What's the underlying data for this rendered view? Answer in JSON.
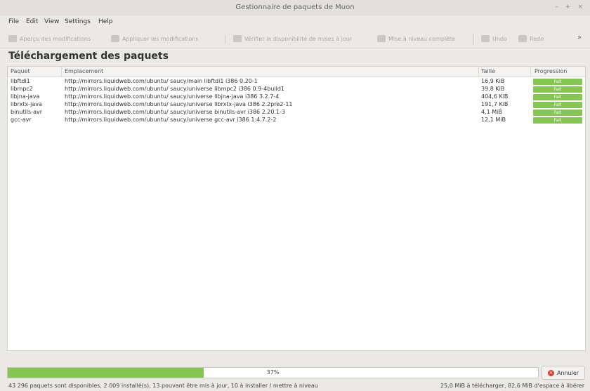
{
  "window": {
    "title": "Gestionnaire de paquets de Muon",
    "controls": [
      "–",
      "+",
      "×"
    ]
  },
  "menu": [
    {
      "label": "File"
    },
    {
      "label": "Edit"
    },
    {
      "label": "View"
    },
    {
      "label": "Settings"
    },
    {
      "label": "Help"
    }
  ],
  "toolbar": [
    {
      "label": "Aperçu des modifications",
      "icon": "preview-icon"
    },
    {
      "label": "Appliquer les modifications",
      "icon": "apply-icon"
    },
    {
      "label": "Vérifier la disponibilité de mises à jour",
      "icon": "refresh-icon"
    },
    {
      "label": "Mise à niveau complète",
      "icon": "upgrade-icon"
    },
    {
      "label": "Undo",
      "icon": "undo-icon"
    },
    {
      "label": "Redo",
      "icon": "redo-icon"
    },
    {
      "label": "»",
      "icon": "overflow-icon"
    }
  ],
  "page_title": "Téléchargement des paquets",
  "table": {
    "headers": [
      "Paquet",
      "Emplacement",
      "Taille",
      "Progression"
    ],
    "rows": [
      {
        "pkg": "libftdi1",
        "loc": "http://mirrors.liquidweb.com/ubuntu/ saucy/main libftdi1 i386 0.20-1",
        "size": "16,9 KiB",
        "progress": "Fait"
      },
      {
        "pkg": "libmpc2",
        "loc": "http://mirrors.liquidweb.com/ubuntu/ saucy/universe libmpc2 i386 0.9-4build1",
        "size": "39,8 KiB",
        "progress": "Fait"
      },
      {
        "pkg": "libjna-java",
        "loc": "http://mirrors.liquidweb.com/ubuntu/ saucy/universe libjna-java i386 3.2.7-4",
        "size": "404,6 KiB",
        "progress": "Fait"
      },
      {
        "pkg": "librxtx-java",
        "loc": "http://mirrors.liquidweb.com/ubuntu/ saucy/universe librxtx-java i386 2.2pre2-11",
        "size": "191,7 KiB",
        "progress": "Fait"
      },
      {
        "pkg": "binutils-avr",
        "loc": "http://mirrors.liquidweb.com/ubuntu/ saucy/universe binutils-avr i386 2.20.1-3",
        "size": "4,1 MiB",
        "progress": "Fait"
      },
      {
        "pkg": "gcc-avr",
        "loc": "http://mirrors.liquidweb.com/ubuntu/ saucy/universe gcc-avr i386 1:4.7.2-2",
        "size": "12,1 MiB",
        "progress": "Fait"
      }
    ]
  },
  "progress": {
    "value": 0.37,
    "label": "37%"
  },
  "cancel_label": "Annuler",
  "status": {
    "left": "43 296 paquets sont disponibles, 2 009 installé(s), 13 pouvant être mis à jour, 10 à installer / mettre à niveau",
    "right": "25,0 MiB à télécharger, 82,6 MiB d'espace à libérer"
  },
  "colors": {
    "accent": "#86c454",
    "cancel": "#d9412f"
  }
}
